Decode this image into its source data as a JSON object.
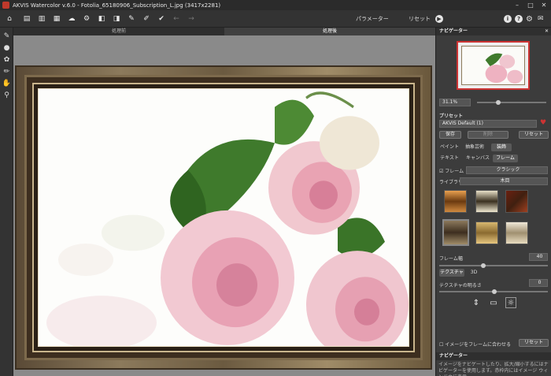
{
  "window": {
    "title": "AKVIS Watercolor v.6.0 - Fotolia_65180906_Subscription_L.jpg (3417x2281)",
    "controls": {
      "minimize": "–",
      "maximize": "□",
      "close": "✕"
    }
  },
  "toolbar": {
    "parameters_label": "パラメーター",
    "reset_label": "リセット"
  },
  "view_tabs": {
    "before": "処理前",
    "after": "処理後"
  },
  "navigator": {
    "title": "ナビゲーター",
    "zoom": "31.1%",
    "zoom_level": 0.311
  },
  "presets": {
    "title": "プリセット",
    "selected": "AKVIS Default (1)",
    "save_label": "保存",
    "delete_label": "削除",
    "reset_label": "リセット"
  },
  "tabs": {
    "paint": "ペイント",
    "abstract": "抽象芸術",
    "decoration": "装飾"
  },
  "subtabs": {
    "text": "テキスト",
    "canvas": "キャンバス",
    "frame": "フレーム"
  },
  "frame": {
    "checkbox_label": "フレーム",
    "style": "クラシック",
    "library_label": "ライブラリ",
    "library_value": "木目",
    "width_label": "フレーム幅",
    "width_value": "40",
    "texture_tab": "テクスチャ",
    "tab_3d": "3D",
    "texture_brightness_label": "テクスチャの明るさ",
    "texture_brightness_value": "0",
    "fit_label": "イメージをフレームに合わせる",
    "reset_label": "リセット"
  },
  "help": {
    "title": "ナビゲーター",
    "text": "イメージをナビゲートしたり、拡大/縮小するにはナビゲーターを使用します。赤枠内にはイメージ ウィンドウに表示"
  },
  "colors": {
    "accent": "#c0392b",
    "panel_bg": "#3c3c3c",
    "canvas_bg": "#8a8a8a"
  }
}
